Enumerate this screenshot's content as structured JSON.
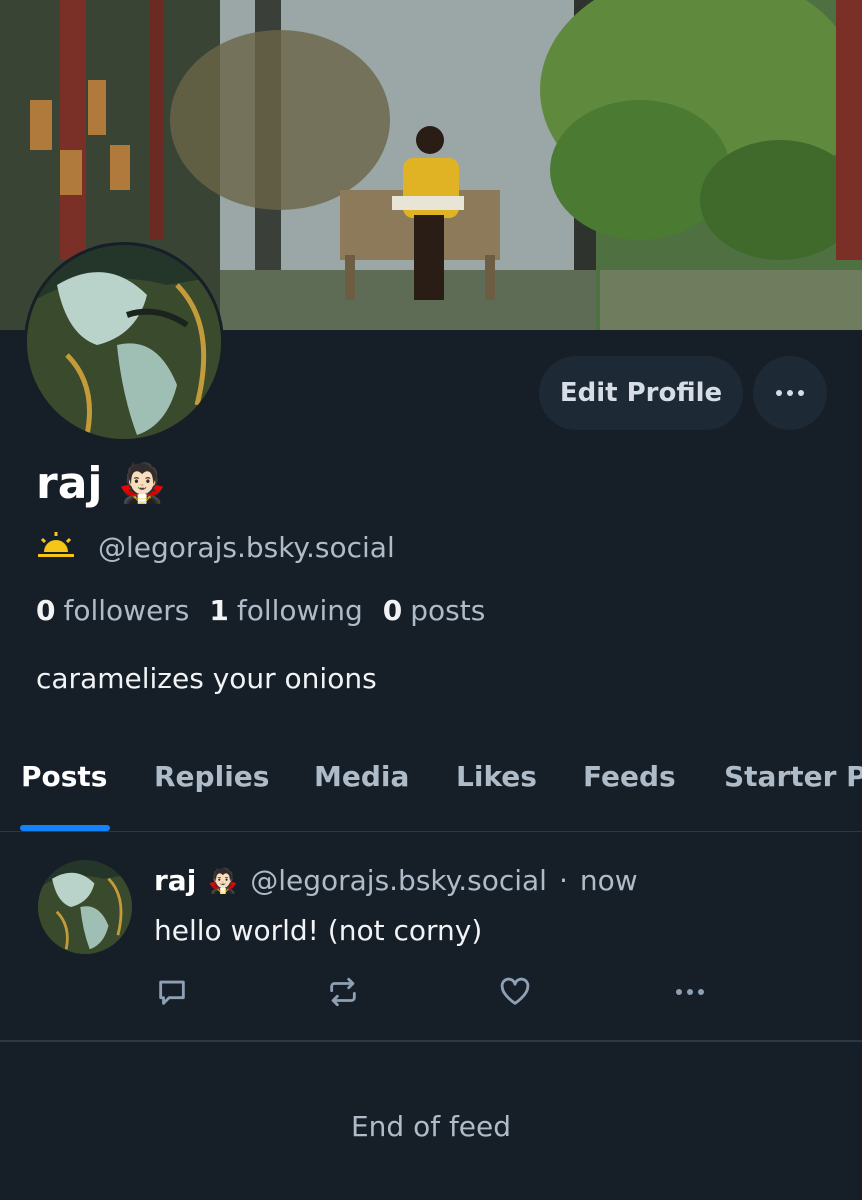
{
  "profile": {
    "display_name": "raj",
    "name_emoji": "🧛🏻",
    "status_icon": "sunrise-icon",
    "handle": "@legorajs.bsky.social",
    "stats": {
      "followers_count": "0",
      "followers_label": "followers",
      "following_count": "1",
      "following_label": "following",
      "posts_count": "0",
      "posts_label": "posts"
    },
    "bio": "caramelizes your onions"
  },
  "actions": {
    "edit_profile_label": "Edit Profile",
    "more_icon": "ellipsis-icon"
  },
  "tabs": [
    {
      "label": "Posts",
      "active": true
    },
    {
      "label": "Replies"
    },
    {
      "label": "Media"
    },
    {
      "label": "Likes"
    },
    {
      "label": "Feeds"
    },
    {
      "label": "Starter P"
    }
  ],
  "feed": {
    "posts": [
      {
        "author_name": "raj",
        "author_emoji": "🧛🏻",
        "author_handle": "@legorajs.bsky.social",
        "separator": "·",
        "time": "now",
        "text": "hello world! (not corny)",
        "actions": [
          "reply-icon",
          "repost-icon",
          "like-icon",
          "more-icon"
        ]
      }
    ],
    "end_label": "End of feed"
  },
  "colors": {
    "background": "#161e27",
    "button_bg": "#1e2936",
    "accent": "#1083fe",
    "muted_text": "#aebbc9",
    "sun": "#f5c518"
  }
}
